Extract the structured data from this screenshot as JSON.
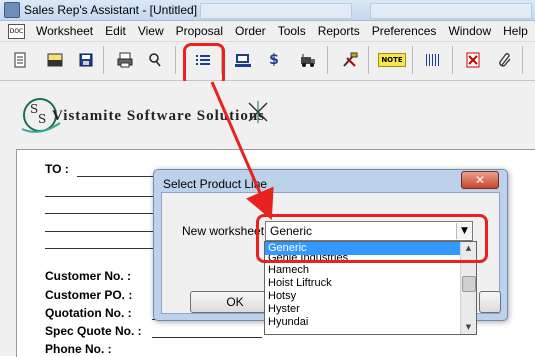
{
  "window": {
    "title": "Sales Rep's Assistant - [Untitled]"
  },
  "menu": {
    "items": [
      "Worksheet",
      "Edit",
      "View",
      "Proposal",
      "Order",
      "Tools",
      "Reports",
      "Preferences",
      "Window",
      "Help"
    ]
  },
  "toolbar": {
    "buttons": [
      "new-icon",
      "open-icon",
      "save-icon",
      "print-icon",
      "search-icon",
      "list-icon",
      "dealer-icon",
      "dollar-icon",
      "truck-icon",
      "tools-icon",
      "note-icon",
      "barcode-icon",
      "pdf-icon",
      "attach-icon"
    ],
    "note_label": "NOTE",
    "dollar_label": "$",
    "highlight_color": "#e8221e"
  },
  "worksheet": {
    "logo_text": "Vistamite Software Solutions",
    "to_label": "TO :",
    "fields": [
      "Customer No. :",
      "Customer PO. :",
      "Quotation No. :",
      "Spec Quote No. :",
      "Phone No. :"
    ]
  },
  "dialog": {
    "title": "Select Product Line",
    "close_label": "✕",
    "new_worksheet_label": "New worksheet",
    "selected_value": "Generic",
    "ok_label": "OK",
    "list_items": [
      "Generic",
      "Genie Industries",
      "Hamech",
      "Hoist Liftruck",
      "Hotsy",
      "Hyster",
      "Hyundai"
    ],
    "selected_color": "#3399ff"
  }
}
